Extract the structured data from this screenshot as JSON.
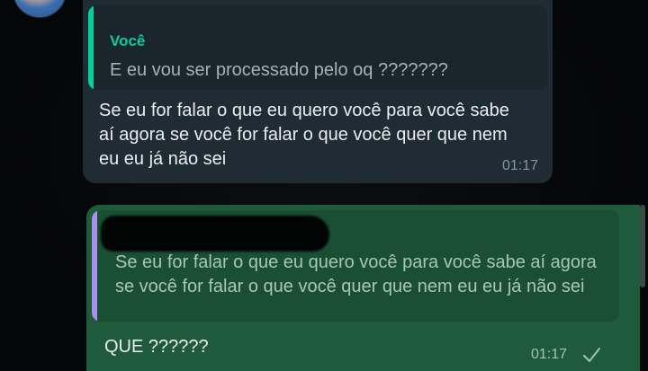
{
  "incoming_message": {
    "quoted": {
      "author": "Você",
      "text": "E eu vou ser processado pelo oq ???????"
    },
    "body": "Se eu for falar o que eu quero você para você sabe aí agora se você for falar o que você quer que nem eu eu já não sei",
    "time": "01:17"
  },
  "outgoing_message": {
    "quoted": {
      "text": "Se eu for falar o que eu quero você para você sabe aí agora se você for falar o que você quer que nem eu eu já não sei"
    },
    "body": "QUE ??????",
    "time": "01:17",
    "status_icon": "single-check-icon"
  },
  "colors": {
    "background": "#07090b",
    "incoming_bubble": "#1f2c34",
    "outgoing_bubble": "#1e5a3b",
    "incoming_quote_bar": "#06cf9c",
    "outgoing_quote_bar": "#a791f0"
  }
}
